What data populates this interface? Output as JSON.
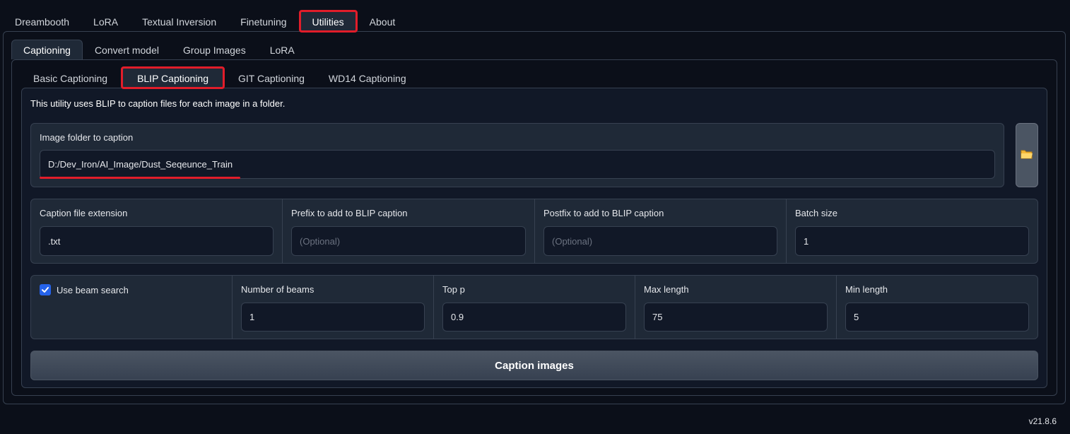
{
  "top_tabs": [
    {
      "label": "Dreambooth",
      "active": false
    },
    {
      "label": "LoRA",
      "active": false
    },
    {
      "label": "Textual Inversion",
      "active": false
    },
    {
      "label": "Finetuning",
      "active": false
    },
    {
      "label": "Utilities",
      "active": true
    },
    {
      "label": "About",
      "active": false
    }
  ],
  "utility_tabs": [
    {
      "label": "Captioning",
      "active": true
    },
    {
      "label": "Convert model",
      "active": false
    },
    {
      "label": "Group Images",
      "active": false
    },
    {
      "label": "LoRA",
      "active": false
    }
  ],
  "caption_tabs": [
    {
      "label": "Basic Captioning",
      "active": false
    },
    {
      "label": "BLIP Captioning",
      "active": true
    },
    {
      "label": "GIT Captioning",
      "active": false
    },
    {
      "label": "WD14 Captioning",
      "active": false
    }
  ],
  "blip": {
    "description": "This utility uses BLIP to caption files for each image in a folder.",
    "image_folder": {
      "label": "Image folder to caption",
      "value": "D:/Dev_Iron/AI_Image/Dust_Seqeunce_Train"
    },
    "folder_icon": "folder-icon",
    "caption_extension": {
      "label": "Caption file extension",
      "value": ".txt"
    },
    "prefix": {
      "label": "Prefix to add to BLIP caption",
      "placeholder": "(Optional)"
    },
    "postfix": {
      "label": "Postfix to add to BLIP caption",
      "placeholder": "(Optional)"
    },
    "batch_size": {
      "label": "Batch size",
      "value": "1"
    },
    "beam_search": {
      "label": "Use beam search",
      "checked": true
    },
    "num_beams": {
      "label": "Number of beams",
      "value": "1"
    },
    "top_p": {
      "label": "Top p",
      "value": "0.9"
    },
    "max_length": {
      "label": "Max length",
      "value": "75"
    },
    "min_length": {
      "label": "Min length",
      "value": "5"
    },
    "caption_button": "Caption images"
  },
  "version": "v21.8.6",
  "colors": {
    "highlight": "#e11d2a",
    "accent": "#2563eb",
    "background": "#0b0f19"
  }
}
